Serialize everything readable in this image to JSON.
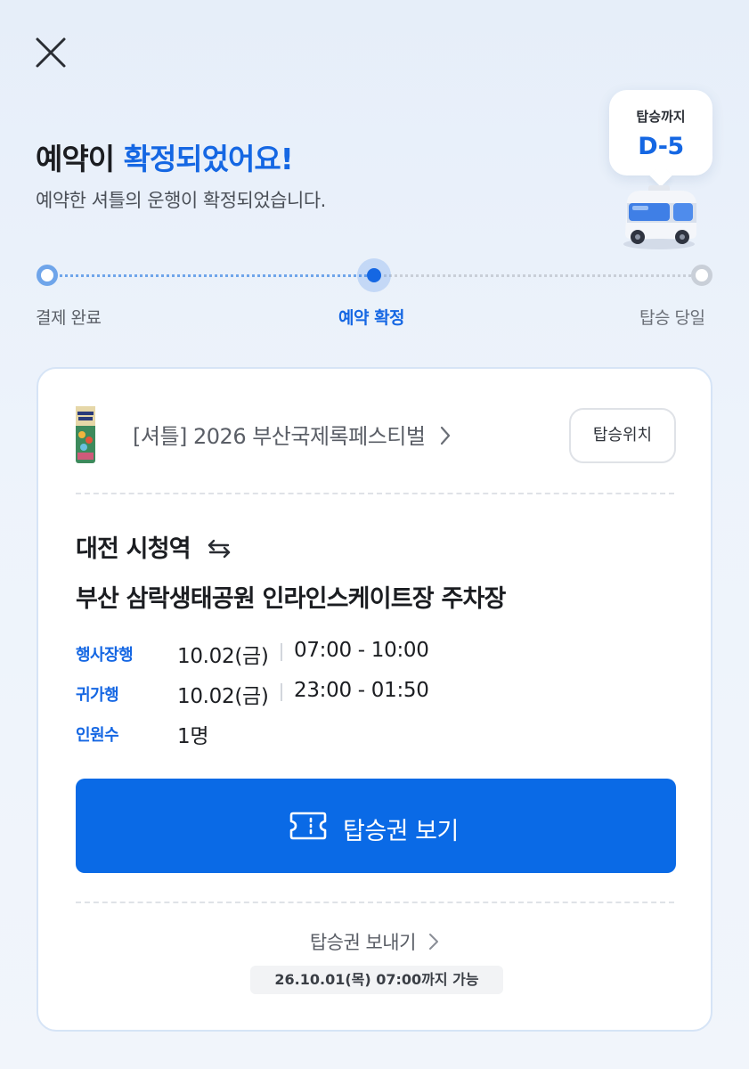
{
  "header": {
    "close_icon": "close-icon",
    "title_prefix": "예약이 ",
    "title_accent": "확정되었어요!",
    "subtitle": "예약한 셔틀의 운행이 확정되었습니다.",
    "accent_color": "#1567e3"
  },
  "dday": {
    "label": "탑승까지",
    "value": "D-5"
  },
  "progress": {
    "steps": [
      {
        "label": "결제 완료",
        "state": "done"
      },
      {
        "label": "예약 확정",
        "state": "current"
      },
      {
        "label": "탑승 당일",
        "state": "upcoming"
      }
    ]
  },
  "card": {
    "event_title": "[셔틀] 2026 부산국제록페스티벌",
    "location_button": "탑승위치",
    "route": {
      "from": "대전 시청역",
      "to": "부산 삼락생태공원 인라인스케이트장 주차장",
      "swap_icon": "swap-arrows-icon"
    },
    "info": [
      {
        "key": "행사장행",
        "date": "10.02(금)",
        "time": "07:00 - 10:00"
      },
      {
        "key": "귀가행",
        "date": "10.02(금)",
        "time": "23:00 - 01:50"
      },
      {
        "key": "인원수",
        "value": "1명"
      }
    ],
    "ticket_button": "탑승권 보기",
    "send_link": "탑승권 보내기",
    "deadline": "26.10.01(목) 07:00까지 가능"
  }
}
